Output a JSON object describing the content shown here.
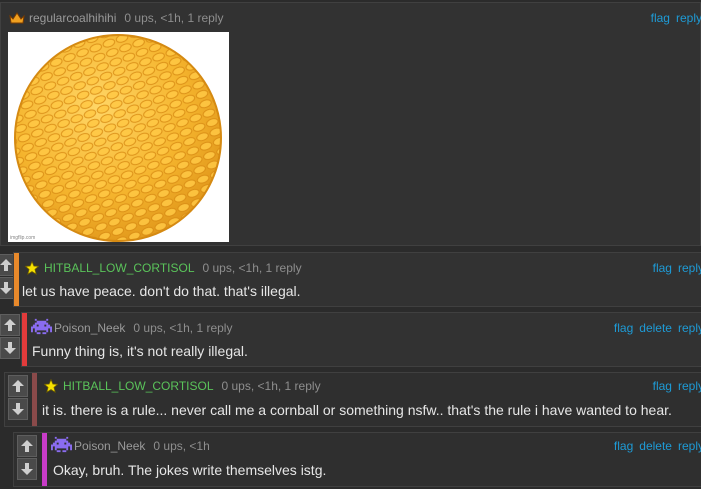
{
  "comments": [
    {
      "username": "regularcoalhihihi",
      "stats": "0 ups, <1h, 1 reply",
      "actions": [
        "flag",
        "reply"
      ],
      "user_color": "#9a9a9a",
      "image_watermark": "imgflip.com"
    },
    {
      "username": "HITBALL_LOW_CORTISOL",
      "stats": "0 ups, <1h, 1 reply",
      "actions": [
        "flag",
        "reply"
      ],
      "text": "let us have peace. don't do that. that's illegal.",
      "user_color": "#5ac35a",
      "stripe_color": "#e8892b"
    },
    {
      "username": "Poison_Neek",
      "stats": "0 ups, <1h, 1 reply",
      "actions": [
        "flag",
        "delete",
        "reply"
      ],
      "text": "Funny thing is, it's not really illegal.",
      "user_color": "#9a9a9a",
      "stripe_color": "#e23b3b"
    },
    {
      "username": "HITBALL_LOW_CORTISOL",
      "stats": "0 ups, <1h, 1 reply",
      "actions": [
        "flag",
        "reply"
      ],
      "text": "it is. there is a rule... never call me a cornball or something nsfw.. that's the rule i have wanted to hear.",
      "user_color": "#5ac35a",
      "stripe_color": "#8a4a4a"
    },
    {
      "username": "Poison_Neek",
      "stats": "0 ups, <1h",
      "actions": [
        "flag",
        "delete",
        "reply"
      ],
      "text": "Okay, bruh. The jokes write themselves istg.",
      "user_color": "#9a9a9a",
      "stripe_color": "#c83cc8"
    }
  ],
  "colors": {
    "background": "#2b2b2b",
    "panel": "#323232",
    "link": "#1e9bd6"
  },
  "icons": {
    "crown": "crown-icon",
    "star": "star-icon",
    "invader": "space-invader-icon",
    "up": "up-arrow-icon",
    "down": "down-arrow-icon"
  }
}
